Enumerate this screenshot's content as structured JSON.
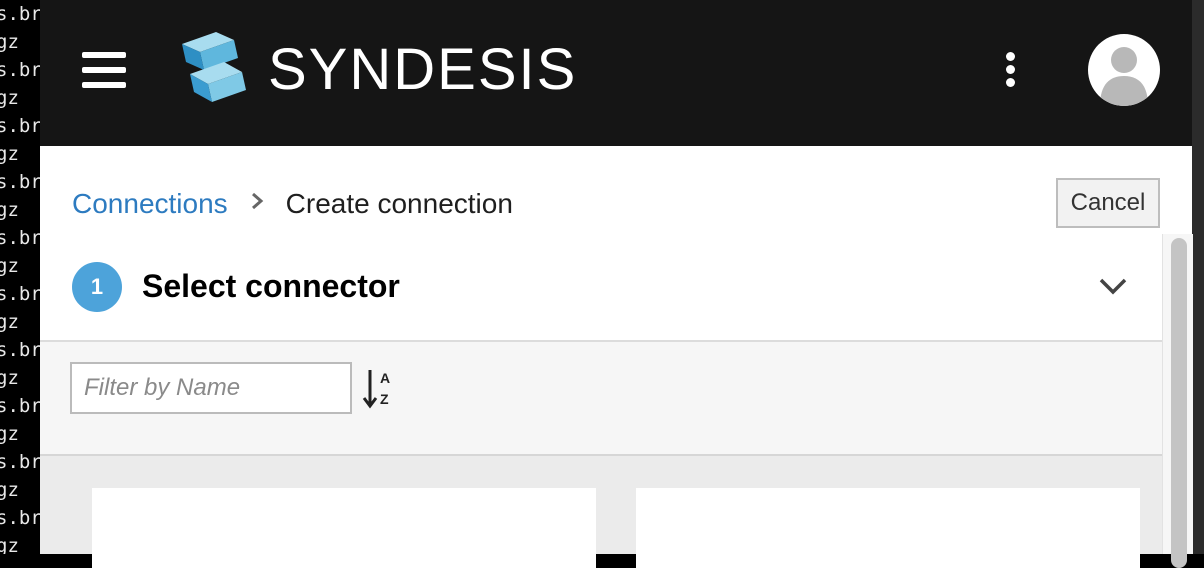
{
  "terminal": {
    "lines": [
      "s.br",
      "gz",
      "s.br",
      "gz",
      "s.br",
      "gz",
      "s.br",
      "gz",
      "s.br",
      "gz",
      "s.br",
      "gz",
      "s.br",
      "gz",
      "s.br",
      "gz",
      "s.br",
      "gz",
      "s.br",
      "gz"
    ]
  },
  "header": {
    "brand": "SYNDESIS",
    "menu_icon": "hamburger-menu-icon",
    "kebab_icon": "kebab-menu-icon",
    "avatar_icon": "user-avatar-icon"
  },
  "breadcrumb": {
    "link": "Connections",
    "separator": "›",
    "current": "Create connection"
  },
  "actions": {
    "cancel_label": "Cancel"
  },
  "step": {
    "number": "1",
    "title": "Select connector",
    "toggle_icon": "chevron-down-icon"
  },
  "filter": {
    "placeholder": "Filter by Name",
    "value": "",
    "sort_icon": "sort-alpha-icon",
    "sort_top": "A",
    "sort_bottom": "Z"
  },
  "colors": {
    "header_bg": "#151515",
    "link": "#2d7bc0",
    "step_badge": "#4da3da",
    "logo_light": "#a8dcef",
    "logo_mid": "#5fb7dd",
    "logo_dark": "#2e8fc4"
  }
}
